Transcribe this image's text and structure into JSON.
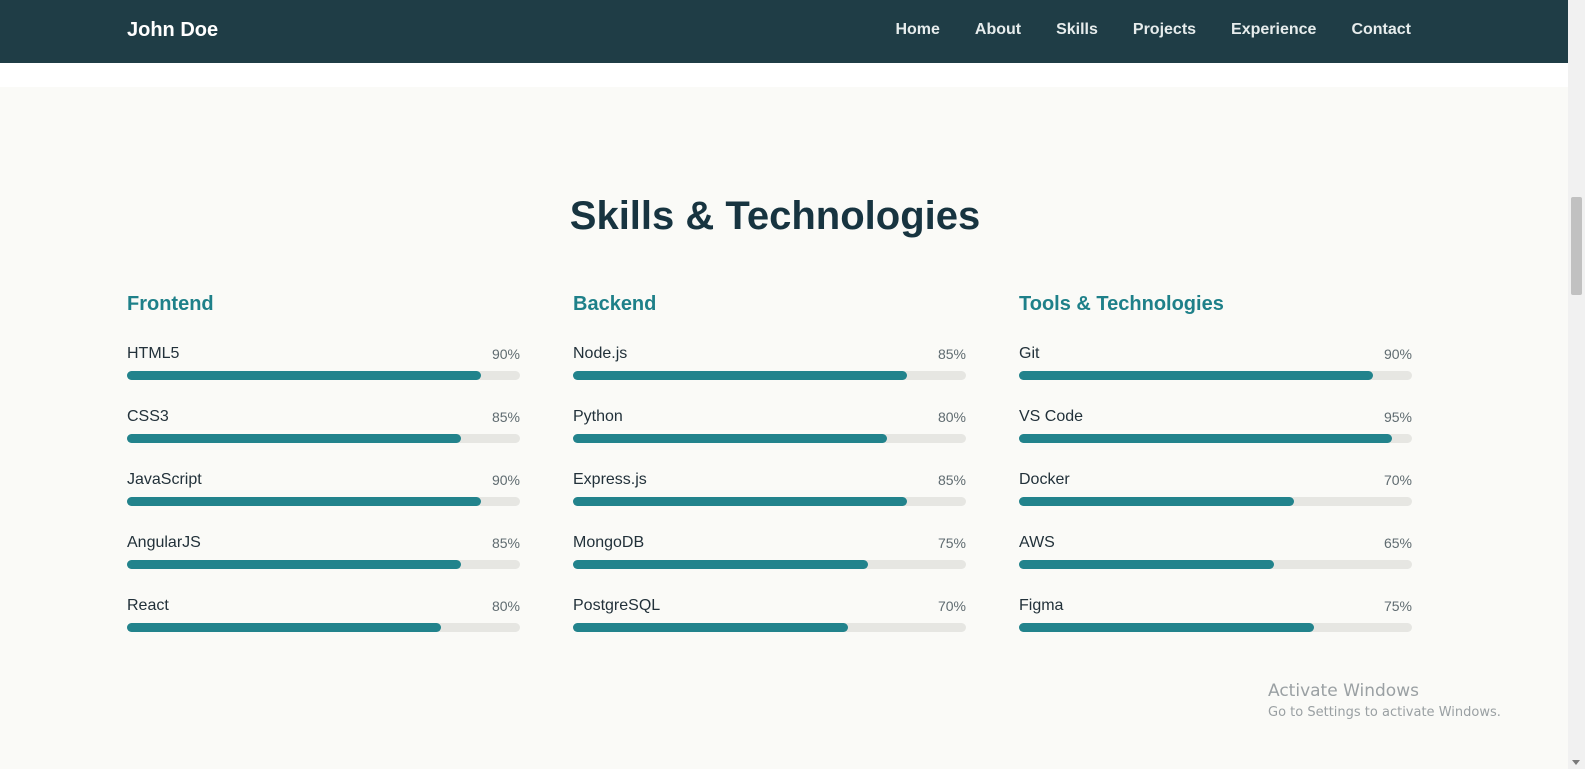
{
  "header": {
    "brand": "John Doe",
    "nav": [
      "Home",
      "About",
      "Skills",
      "Projects",
      "Experience",
      "Contact"
    ]
  },
  "skills_section": {
    "title": "Skills & Technologies",
    "columns": [
      {
        "title": "Frontend",
        "skills": [
          {
            "name": "HTML5",
            "percent_label": "90%",
            "value": 90
          },
          {
            "name": "CSS3",
            "percent_label": "85%",
            "value": 85
          },
          {
            "name": "JavaScript",
            "percent_label": "90%",
            "value": 90
          },
          {
            "name": "AngularJS",
            "percent_label": "85%",
            "value": 85
          },
          {
            "name": "React",
            "percent_label": "80%",
            "value": 80
          }
        ]
      },
      {
        "title": "Backend",
        "skills": [
          {
            "name": "Node.js",
            "percent_label": "85%",
            "value": 85
          },
          {
            "name": "Python",
            "percent_label": "80%",
            "value": 80
          },
          {
            "name": "Express.js",
            "percent_label": "85%",
            "value": 85
          },
          {
            "name": "MongoDB",
            "percent_label": "75%",
            "value": 75
          },
          {
            "name": "PostgreSQL",
            "percent_label": "70%",
            "value": 70
          }
        ]
      },
      {
        "title": "Tools & Technologies",
        "skills": [
          {
            "name": "Git",
            "percent_label": "90%",
            "value": 90
          },
          {
            "name": "VS Code",
            "percent_label": "95%",
            "value": 95
          },
          {
            "name": "Docker",
            "percent_label": "70%",
            "value": 70
          },
          {
            "name": "AWS",
            "percent_label": "65%",
            "value": 65
          },
          {
            "name": "Figma",
            "percent_label": "75%",
            "value": 75
          }
        ]
      }
    ]
  },
  "watermark": {
    "title": "Activate Windows",
    "subtitle": "Go to Settings to activate Windows."
  },
  "colors": {
    "navbar": "#1f3d46",
    "accent": "#1e8089",
    "bar_fill": "#22838c",
    "bar_track": "#e6e6e2"
  }
}
